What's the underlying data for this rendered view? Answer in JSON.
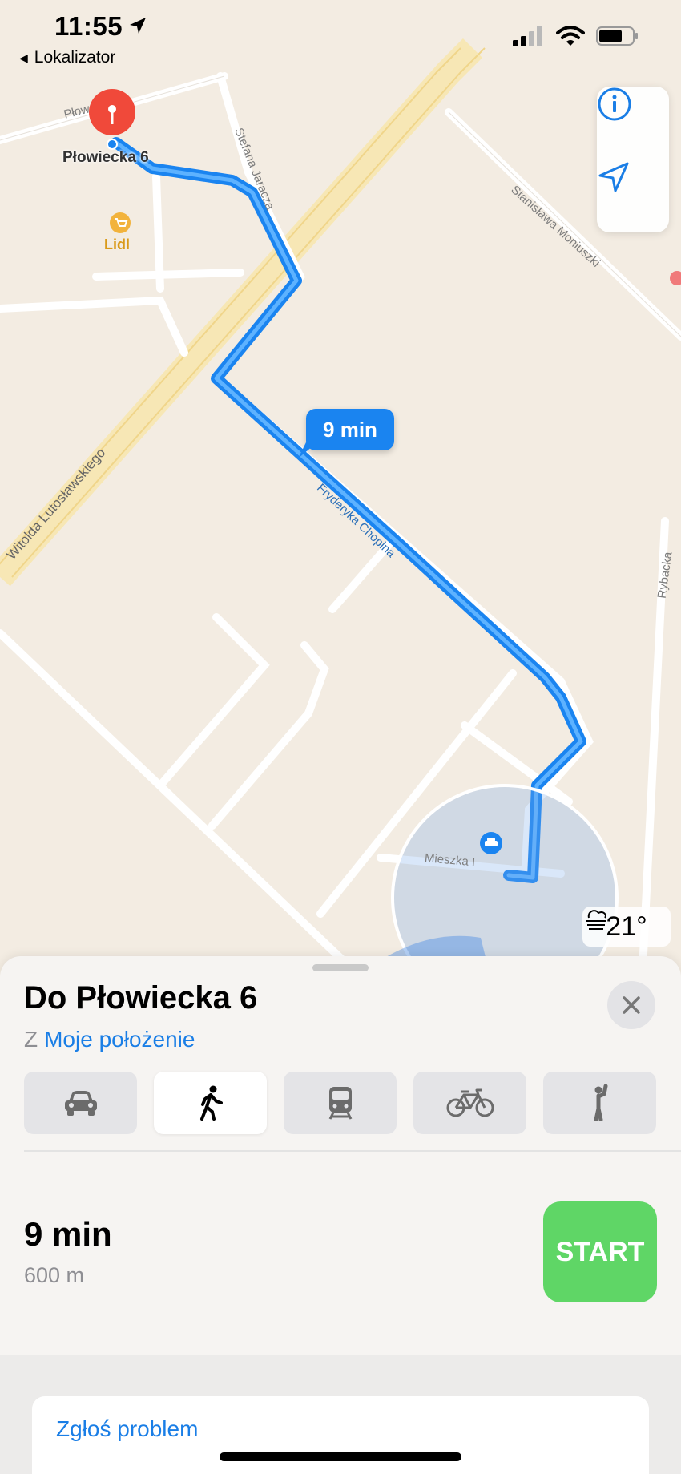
{
  "status_bar": {
    "time": "11:55",
    "back_app": "Lokalizator"
  },
  "map": {
    "destination_label": "Płowiecka 6",
    "poi_label": "Lidl",
    "eta_bubble": "9 min",
    "streets": {
      "s1": "Płow",
      "s2": "Stefana Jaracza",
      "s3": "Stanisława Moniuszki",
      "s4": "Witolda Lutosławskiego",
      "s5": "Fryderyka Chopina",
      "s6": "Rybacka",
      "s7": "Mieszka I"
    },
    "weather": {
      "temp": "21°",
      "icon": "fog-cloud-icon"
    },
    "colors": {
      "route": "#1a84f0",
      "pin": "#f0493a",
      "poi": "#f2b33d"
    }
  },
  "sheet": {
    "title": "Do Płowiecka 6",
    "from_prefix": "Z",
    "from_link": "Moje położenie",
    "modes": [
      "car-icon",
      "walk-icon",
      "transit-icon",
      "bike-icon",
      "rideshare-icon"
    ],
    "active_mode": "walk-icon",
    "route": {
      "time": "9 min",
      "distance": "600 m"
    },
    "start_label": "START",
    "report_label": "Zgłoś problem",
    "colors": {
      "start": "#5fd666",
      "link": "#1a7ee6"
    }
  }
}
